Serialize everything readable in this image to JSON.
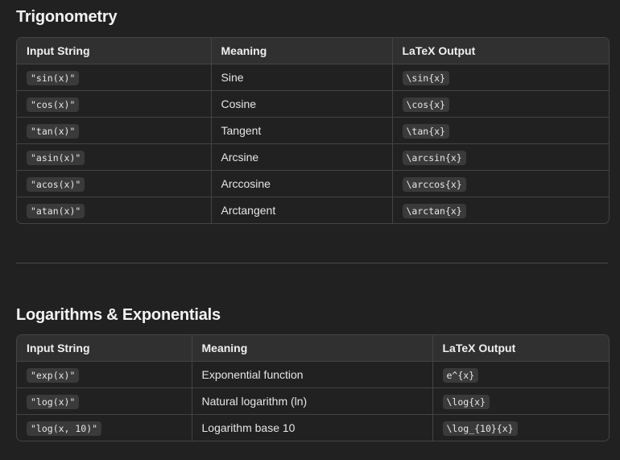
{
  "sections": [
    {
      "title": "Trigonometry",
      "headers": [
        "Input String",
        "Meaning",
        "LaTeX Output"
      ],
      "rows": [
        {
          "input": "\"sin(x)\"",
          "meaning": "Sine",
          "latex": "\\sin{x}"
        },
        {
          "input": "\"cos(x)\"",
          "meaning": "Cosine",
          "latex": "\\cos{x}"
        },
        {
          "input": "\"tan(x)\"",
          "meaning": "Tangent",
          "latex": "\\tan{x}"
        },
        {
          "input": "\"asin(x)\"",
          "meaning": "Arcsine",
          "latex": "\\arcsin{x}"
        },
        {
          "input": "\"acos(x)\"",
          "meaning": "Arccosine",
          "latex": "\\arccos{x}"
        },
        {
          "input": "\"atan(x)\"",
          "meaning": "Arctangent",
          "latex": "\\arctan{x}"
        }
      ]
    },
    {
      "title": "Logarithms & Exponentials",
      "headers": [
        "Input String",
        "Meaning",
        "LaTeX Output"
      ],
      "rows": [
        {
          "input": "\"exp(x)\"",
          "meaning": "Exponential function",
          "latex": "e^{x}"
        },
        {
          "input": "\"log(x)\"",
          "meaning": "Natural logarithm (ln)",
          "latex": "\\log{x}"
        },
        {
          "input": "\"log(x, 10)\"",
          "meaning": "Logarithm base 10",
          "latex": "\\log_{10}{x}"
        }
      ]
    }
  ]
}
